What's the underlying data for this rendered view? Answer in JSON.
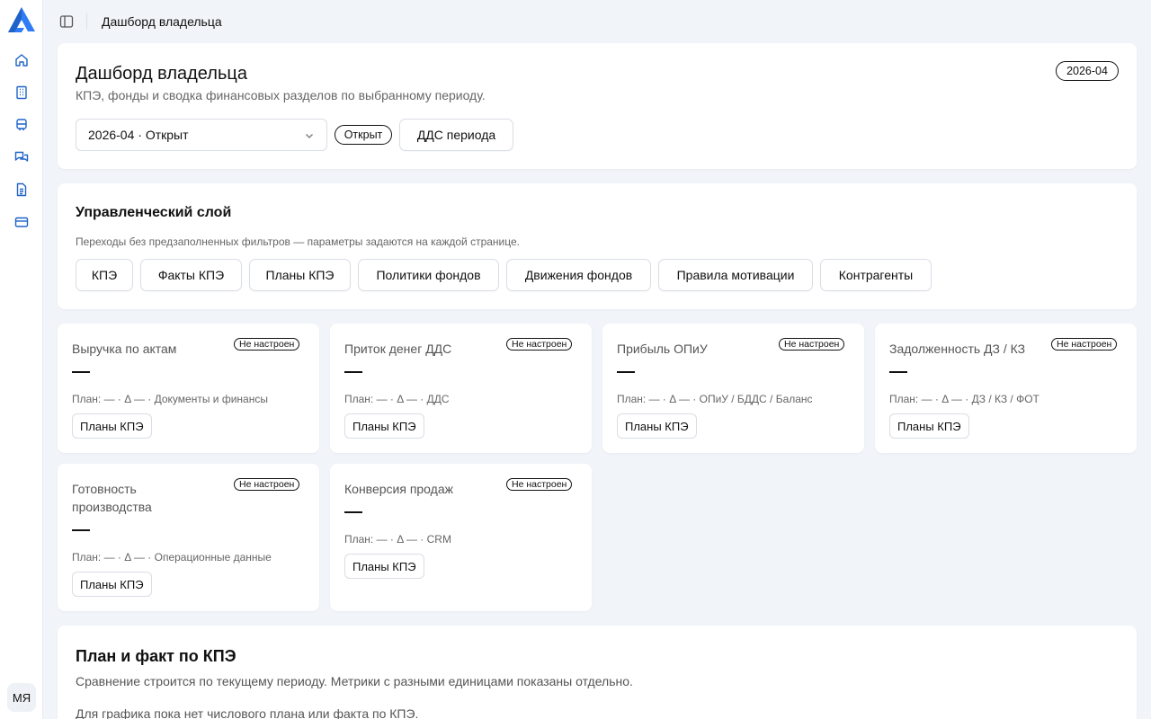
{
  "sidebar": {
    "logo": "logo-icon",
    "items": [
      {
        "icon": "home-icon"
      },
      {
        "icon": "building-icon"
      },
      {
        "icon": "train-icon"
      },
      {
        "icon": "chat-icon"
      },
      {
        "icon": "document-icon"
      },
      {
        "icon": "card-icon"
      }
    ],
    "avatar": "МЯ"
  },
  "topbar": {
    "title": "Дашборд владельца"
  },
  "header": {
    "title": "Дашборд владельца",
    "subtitle": "КПЭ, фонды и сводка финансовых разделов по выбранному периоду.",
    "period_badge": "2026-04",
    "period_select": "2026-04 · Открыт",
    "status_pill": "Открыт",
    "dds_button": "ДДС периода"
  },
  "management": {
    "title": "Управленческий слой",
    "subtitle": "Переходы без предзаполненных фильтров — параметры задаются на каждой странице.",
    "buttons": [
      "КПЭ",
      "Факты КПЭ",
      "Планы КПЭ",
      "Политики фондов",
      "Движения фондов",
      "Правила мотивации",
      "Контрагенты"
    ]
  },
  "kpis": [
    {
      "title": "Выручка по актам",
      "badge": "Не настроен",
      "value": "—",
      "meta": "План: — · Δ — · Документы и финансы",
      "button": "Планы КПЭ"
    },
    {
      "title": "Приток денег ДДС",
      "badge": "Не настроен",
      "value": "—",
      "meta": "План: — · Δ — · ДДС",
      "button": "Планы КПЭ"
    },
    {
      "title": "Прибыль ОПиУ",
      "badge": "Не настроен",
      "value": "—",
      "meta": "План: — · Δ — · ОПиУ / БДДС / Баланс",
      "button": "Планы КПЭ"
    },
    {
      "title": "Задолженность ДЗ / КЗ",
      "badge": "Не настроен",
      "value": "—",
      "meta": "План: — · Δ — · ДЗ / КЗ / ФОТ",
      "button": "Планы КПЭ"
    },
    {
      "title": "Готовность производства",
      "badge": "Не настроен",
      "value": "—",
      "meta": "План: — · Δ — · Операционные данные",
      "button": "Планы КПЭ"
    },
    {
      "title": "Конверсия продаж",
      "badge": "Не настроен",
      "value": "—",
      "meta": "План: — · Δ — · CRM",
      "button": "Планы КПЭ"
    }
  ],
  "plan_fact": {
    "title": "План и факт по КПЭ",
    "subtitle": "Сравнение строится по текущему периоду. Метрики с разными единицами показаны отдельно.",
    "empty": "Для графика пока нет числового плана или факта по КПЭ."
  },
  "colors": {
    "accent": "#1f63c8",
    "logo": "#2f7cf6",
    "background": "#f1f4f8"
  }
}
